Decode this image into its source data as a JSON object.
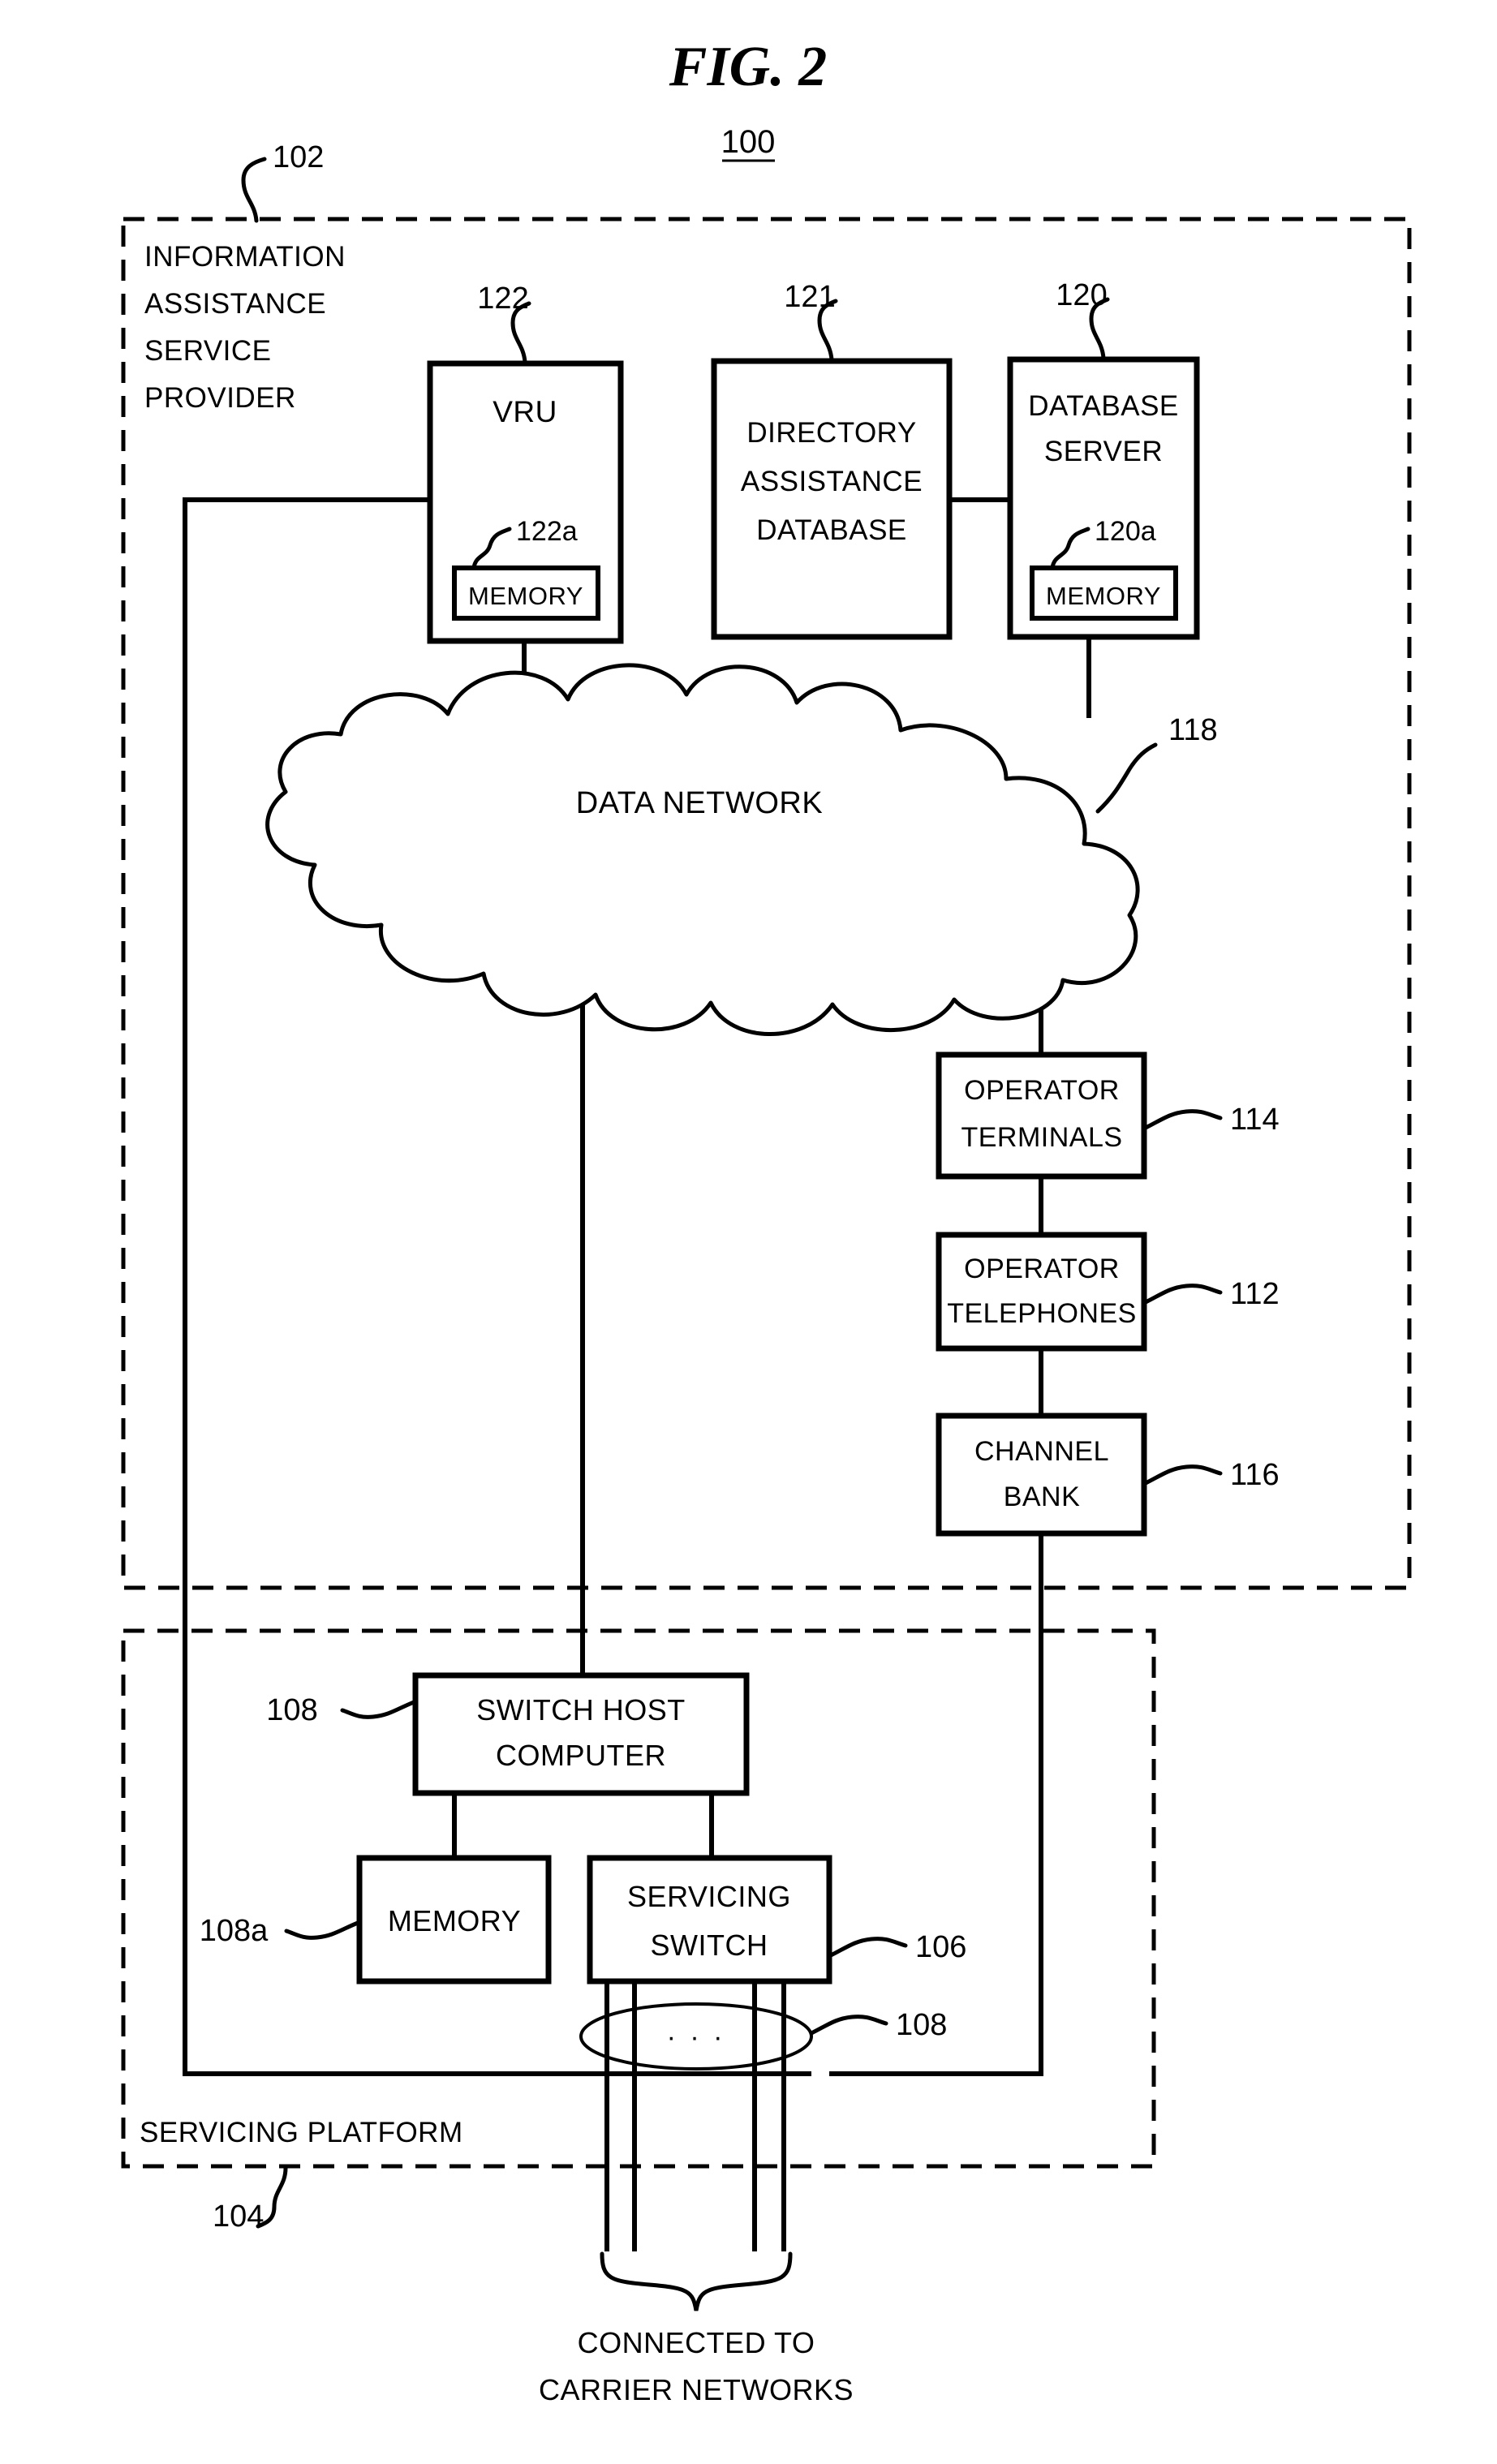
{
  "figure": {
    "title": "FIG.  2",
    "system_number": "100"
  },
  "regions": {
    "provider": {
      "ref": "102",
      "label_lines": [
        "INFORMATION",
        "ASSISTANCE",
        "SERVICE",
        "PROVIDER"
      ]
    },
    "platform": {
      "ref": "104",
      "label": "SERVICING PLATFORM"
    }
  },
  "blocks": {
    "vru": {
      "ref": "122",
      "label": "VRU",
      "memory_ref": "122a",
      "memory_label": "MEMORY"
    },
    "da_database": {
      "ref": "121",
      "label_lines": [
        "DIRECTORY",
        "ASSISTANCE",
        "DATABASE"
      ]
    },
    "db_server": {
      "ref": "120",
      "label_lines": [
        "DATABASE",
        "SERVER"
      ],
      "memory_ref": "120a",
      "memory_label": "MEMORY"
    },
    "data_network": {
      "ref": "118",
      "label": "DATA NETWORK"
    },
    "operator_terminals": {
      "ref": "114",
      "label_lines": [
        "OPERATOR",
        "TERMINALS"
      ]
    },
    "operator_telephones": {
      "ref": "112",
      "label_lines": [
        "OPERATOR",
        "TELEPHONES"
      ]
    },
    "channel_bank": {
      "ref": "116",
      "label_lines": [
        "CHANNEL",
        "BANK"
      ]
    },
    "switch_host": {
      "ref": "108",
      "label_lines": [
        "SWITCH HOST",
        "COMPUTER"
      ]
    },
    "switch_memory": {
      "ref": "108a",
      "label": "MEMORY"
    },
    "servicing_switch": {
      "ref": "106",
      "label_lines": [
        "SERVICING",
        "SWITCH"
      ]
    },
    "trunks": {
      "ref": "108",
      "ellipsis": "· · ·"
    }
  },
  "footer": {
    "caption_lines": [
      "CONNECTED TO",
      "CARRIER NETWORKS"
    ]
  },
  "colors": {
    "ink": "#000000",
    "paper": "#ffffff"
  }
}
